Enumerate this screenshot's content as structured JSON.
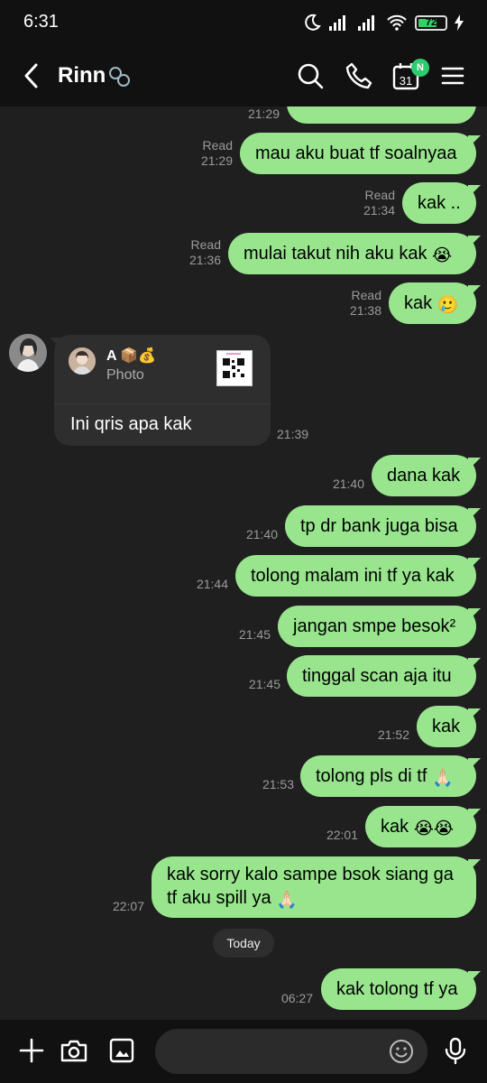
{
  "status_bar": {
    "time": "6:31",
    "battery_level": "72",
    "battery_fraction": 0.72
  },
  "header": {
    "title": "Rinn",
    "calendar_date": "31",
    "calendar_badge": "N"
  },
  "messages": [
    {
      "text": "mau aku buat tf soalnyaa",
      "status": "Read",
      "time": "21:29"
    },
    {
      "text": "kak ..",
      "status": "Read",
      "time": "21:34"
    },
    {
      "text": "mulai takut nih aku kak",
      "emoji": "😭",
      "status": "Read",
      "time": "21:36"
    },
    {
      "text": "kak",
      "emoji": "🥲",
      "status": "Read",
      "time": "21:38"
    },
    {
      "text": "dana kak",
      "time": "21:40"
    },
    {
      "text": "tp dr bank juga bisa",
      "time": "21:40"
    },
    {
      "text": "tolong malam ini tf ya kak",
      "time": "21:44"
    },
    {
      "text": "jangan smpe besok²",
      "time": "21:45"
    },
    {
      "text": "tinggal scan aja itu",
      "time": "21:45"
    },
    {
      "text": "kak",
      "time": "21:52"
    },
    {
      "text": "tolong pls di tf",
      "emoji": "🙏🏻",
      "time": "21:53"
    },
    {
      "text": "kak",
      "emoji": "😭😭",
      "time": "22:01"
    },
    {
      "line1": "kak sorry kalo sampe bsok siang ga",
      "line2": "tf aku spill ya",
      "emoji": "🙏🏻",
      "time": "22:07"
    },
    {
      "text": "kak tolong tf ya",
      "time": "06:27"
    }
  ],
  "partial_message": {
    "time": "21:29"
  },
  "received": {
    "quote_name": "A",
    "quote_emoji": "📦💰",
    "quote_type": "Photo",
    "text": "Ini qris apa kak",
    "time": "21:39"
  },
  "date_divider": "Today"
}
